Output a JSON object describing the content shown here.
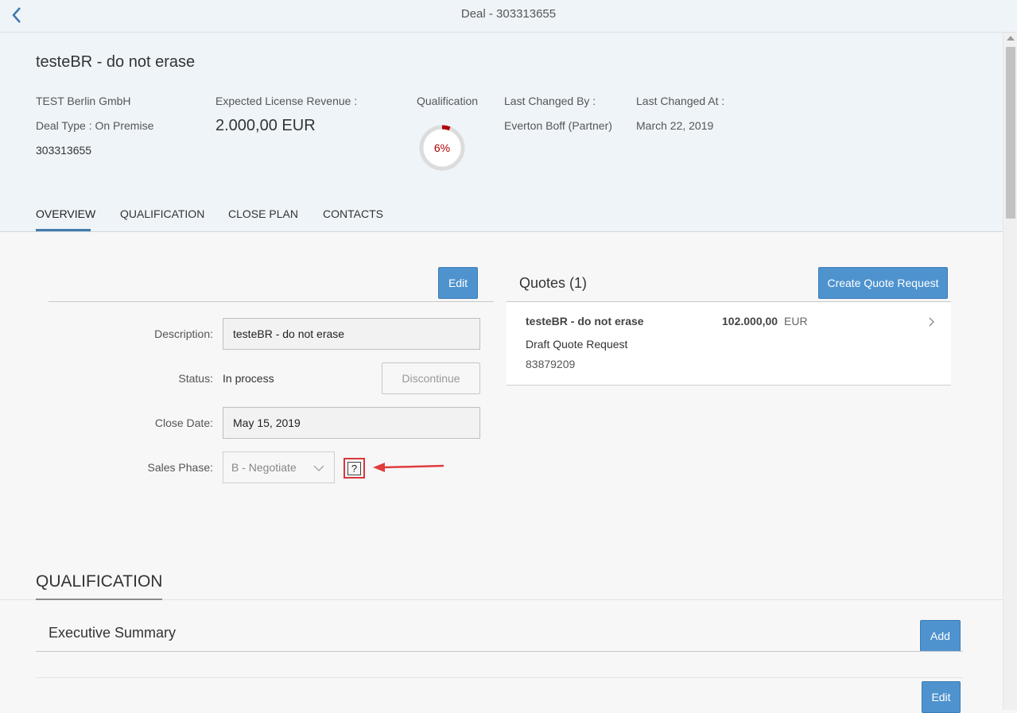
{
  "topbar": {
    "title": "Deal - 303313655"
  },
  "header": {
    "title": "testeBR - do not erase",
    "company": "TEST Berlin GmbH",
    "deal_type": "Deal Type : On Premise",
    "deal_id": "303313655",
    "revenue_label": "Expected License Revenue :",
    "revenue_value": "2.000,00 EUR",
    "qualification_label": "Qualification",
    "qualification_percent": "6%",
    "qualification_fraction": 0.06,
    "last_changed_by_label": "Last Changed By :",
    "last_changed_by_value": "Everton Boff (Partner)",
    "last_changed_at_label": "Last Changed At :",
    "last_changed_at_value": "March 22, 2019"
  },
  "tabs": [
    {
      "label": "OVERVIEW",
      "active": true
    },
    {
      "label": "QUALIFICATION",
      "active": false
    },
    {
      "label": "CLOSE PLAN",
      "active": false
    },
    {
      "label": "CONTACTS",
      "active": false
    }
  ],
  "form": {
    "edit_label": "Edit",
    "description_label": "Description:",
    "description_value": "testeBR - do not erase",
    "status_label": "Status:",
    "status_value": "In process",
    "discontinue_label": "Discontinue",
    "close_date_label": "Close Date:",
    "close_date_value": "May 15, 2019",
    "sales_phase_label": "Sales Phase:",
    "sales_phase_value": "B - Negotiate",
    "help_symbol": "?"
  },
  "quotes": {
    "title": "Quotes (1)",
    "create_label": "Create Quote Request",
    "items": [
      {
        "name": "testeBR - do not erase",
        "amount": "102.000,00",
        "currency": "EUR",
        "status": "Draft Quote Request",
        "id": "83879209"
      }
    ]
  },
  "qualification_section": {
    "title": "QUALIFICATION",
    "executive_summary": "Executive Summary",
    "add_label": "Add",
    "edit_label": "Edit"
  },
  "colors": {
    "accent": "#4e93ce",
    "tab_underline": "#427cac",
    "progress": "#b00000",
    "annotation": "#d9373c"
  }
}
